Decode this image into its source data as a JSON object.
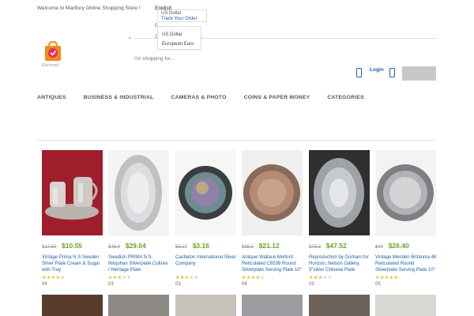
{
  "topbar": {
    "welcome": "Welcome to Martfury Online Shopping Store !",
    "language": "English",
    "currency_option_top": "US Dollar",
    "track_order": "Track Your Order",
    "stub_1": "E",
    "stub_2": "C",
    "currency_options": [
      "US Dollar",
      "European Euro"
    ]
  },
  "header": {
    "logo_text": "Electronic",
    "search_placeholder": "I'm shopping for...",
    "login_label": "Login"
  },
  "nav": {
    "items": [
      "ANTIQUES",
      "BUSINESS & INDUSTRIAL",
      "CAMERAS & PHOTO",
      "COINS & PAPER MONEY",
      "CATEGORIES"
    ]
  },
  "products": [
    {
      "old_price": "$17.59",
      "price": "$10.55",
      "title": "Vintage Prima N S Sweden Silver Plate Cream & Sugar with Tray",
      "rating": 4,
      "reviews": "04"
    },
    {
      "old_price": "$48.4",
      "price": "$29.04",
      "title": "Swedish PRIMA N.S. Nilsjohan Silverplate Culture / Heritage Plate",
      "rating": 3,
      "reviews": "03"
    },
    {
      "old_price": "$5.27",
      "price": "$3.16",
      "title": "Castleton International Silver Company",
      "rating": 3,
      "reviews": "03"
    },
    {
      "old_price": "$35.2",
      "price": "$21.12",
      "title": "Antique Wallace Melford Reticulated C6539 Round Silverplate Serving Plate 10\"",
      "rating": 4,
      "reviews": "04"
    },
    {
      "old_price": "$79.2",
      "price": "$47.52",
      "title": "Reproduction by Gorham for Horizon, Nelson Gallery, 9\"silver Chinese Plate",
      "rating": 3,
      "reviews": "03"
    },
    {
      "old_price": "$44",
      "price": "$26.40",
      "title": "Vintage Meriden Britannia 48 Reticulated Round Silverplate Serving Plate 10\"",
      "rating": 5,
      "reviews": "05"
    }
  ],
  "colors": {
    "accent_link": "#1f5fa6",
    "price_green": "#6aa221",
    "star_gold": "#f2b01e",
    "logo_orange": "#f28a1c"
  }
}
